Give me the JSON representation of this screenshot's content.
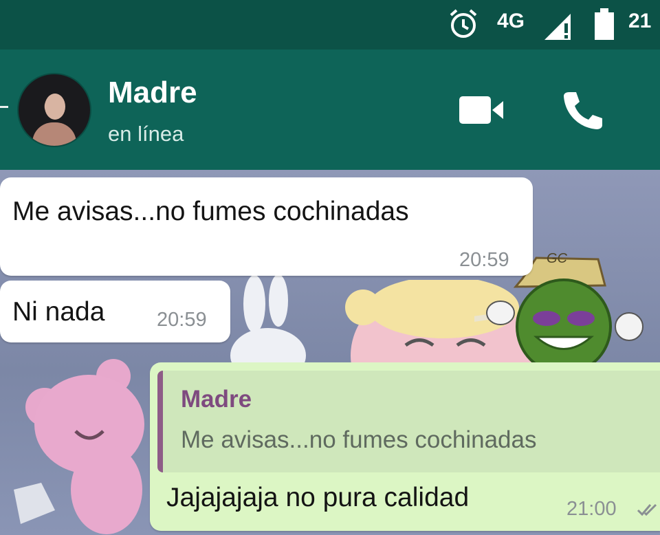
{
  "status_bar": {
    "network": "4G",
    "time": "21"
  },
  "header": {
    "contact_name": "Madre",
    "contact_status": "en línea",
    "icons": [
      "video-call-icon",
      "voice-call-icon"
    ]
  },
  "messages": [
    {
      "direction": "incoming",
      "text": "Me avisas...no fumes cochinadas",
      "time": "20:59"
    },
    {
      "direction": "incoming",
      "text": "Ni nada",
      "time": "20:59"
    },
    {
      "direction": "outgoing",
      "quoted": {
        "author": "Madre",
        "text": "Me avisas...no fumes cochinadas"
      },
      "text": "Jajajajaja no pura calidad",
      "time": "21:00",
      "status_icon": "double-check-icon"
    }
  ],
  "watermark": {
    "text": "GC"
  },
  "colors": {
    "status_bar": "#0c5247",
    "header": "#0e6458",
    "incoming_bubble": "#ffffff",
    "outgoing_bubble": "#dcf6c4",
    "quote_author": "#7e4a7f"
  }
}
